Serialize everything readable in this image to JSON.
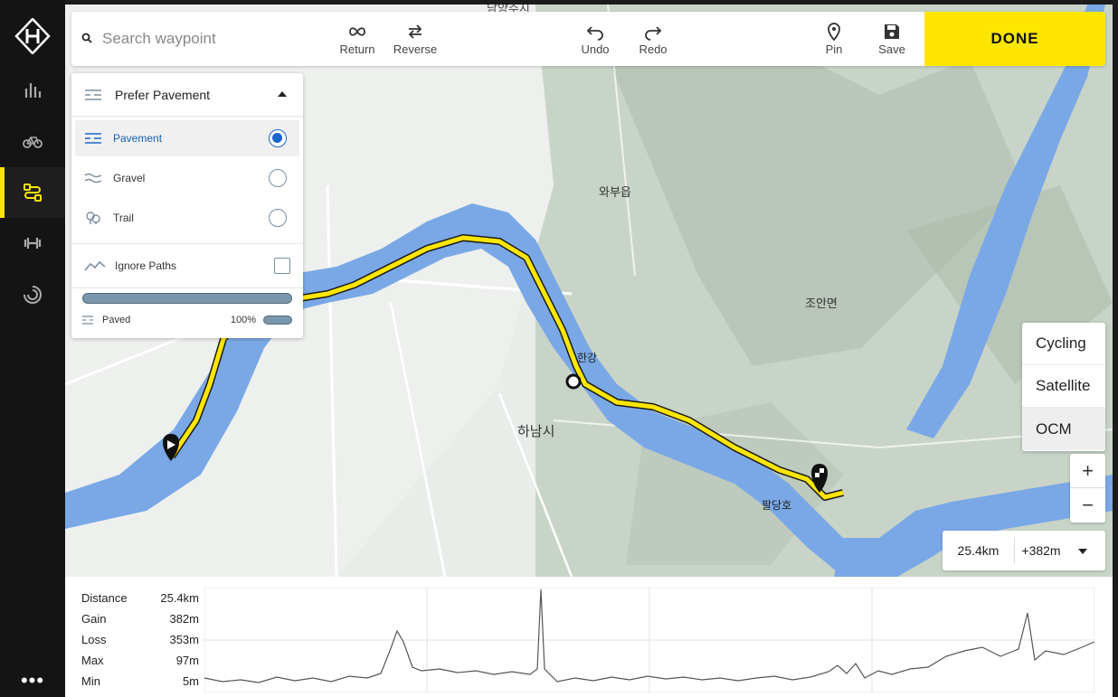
{
  "toolbar": {
    "search_placeholder": "Search waypoint",
    "tools": {
      "return": "Return",
      "reverse": "Reverse",
      "undo": "Undo",
      "redo": "Redo",
      "pin": "Pin",
      "save": "Save"
    },
    "done": "DONE"
  },
  "sidebar": {
    "items": [
      {
        "icon": "stats-icon"
      },
      {
        "icon": "bike-icon"
      },
      {
        "icon": "route-icon",
        "active": true
      },
      {
        "icon": "workout-icon"
      },
      {
        "icon": "activity-icon"
      }
    ],
    "more": "•••"
  },
  "surface": {
    "title": "Prefer Pavement",
    "options": [
      {
        "label": "Pavement",
        "selected": true
      },
      {
        "label": "Gravel",
        "selected": false
      },
      {
        "label": "Trail",
        "selected": false
      }
    ],
    "ignore_paths": "Ignore Paths",
    "paved_label": "Paved",
    "paved_value": "100%",
    "paved_fraction": 1.0
  },
  "map": {
    "labels": {
      "hangang": "한강",
      "hanam": "하남시",
      "paldangho": "팔당호",
      "joan": "조안면",
      "wabu": "와부읍",
      "top": "남양주시"
    },
    "layers": [
      {
        "label": "Cycling",
        "selected": false
      },
      {
        "label": "Satellite",
        "selected": false
      },
      {
        "label": "OCM",
        "selected": true
      }
    ],
    "zoom_in": "+",
    "zoom_out": "−",
    "distance": "25.4km",
    "gain": "+382m"
  },
  "elevation": {
    "stats": [
      {
        "label": "Distance",
        "value": "25.4km"
      },
      {
        "label": "Gain",
        "value": "382m"
      },
      {
        "label": "Loss",
        "value": "353m"
      },
      {
        "label": "Max",
        "value": "97m"
      },
      {
        "label": "Min",
        "value": "5m"
      }
    ]
  },
  "colors": {
    "accent": "#ffe600",
    "water": "#7aa8e6",
    "route": "#ffe600",
    "selected": "#1a66cc"
  }
}
